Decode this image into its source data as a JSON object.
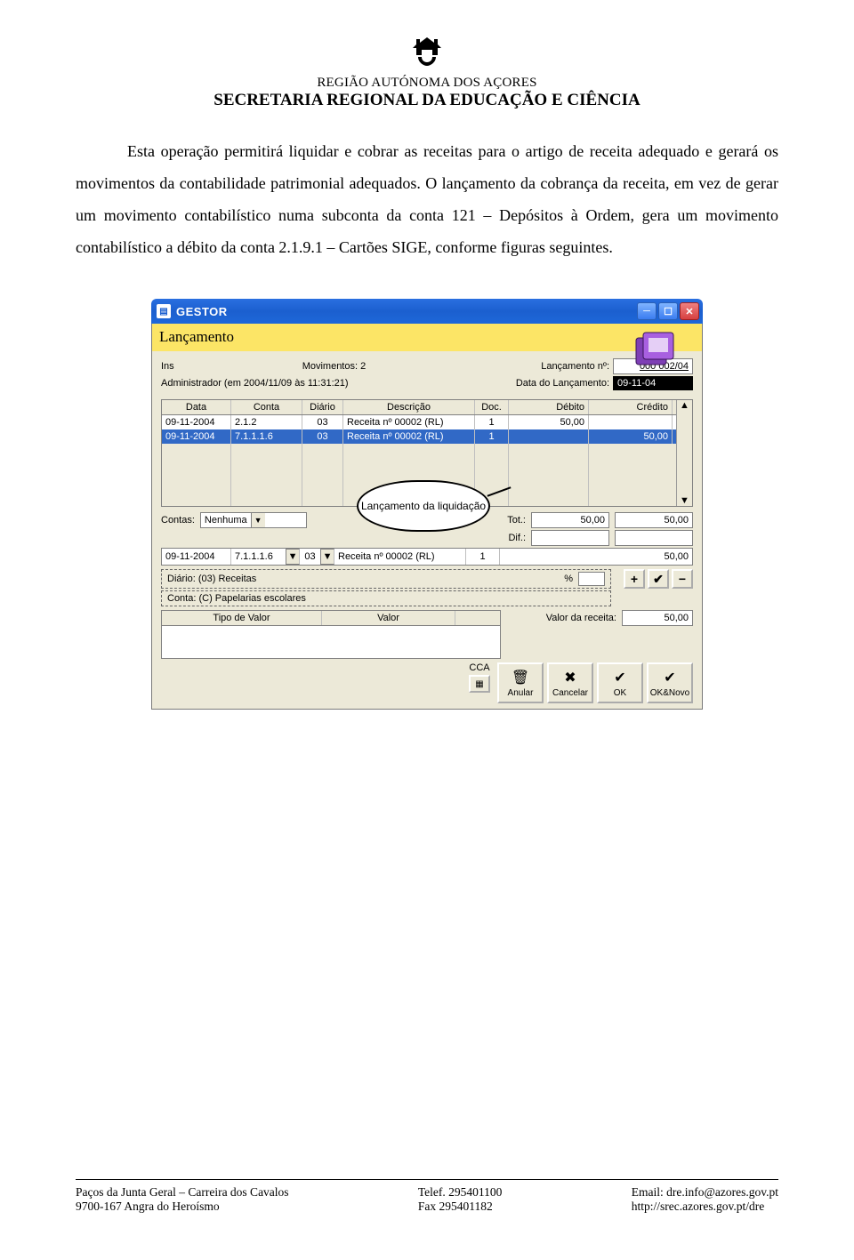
{
  "header": {
    "region": "REGIÃO AUTÓNOMA DOS AÇORES",
    "secretaria": "SECRETARIA REGIONAL DA EDUCAÇÃO E CIÊNCIA"
  },
  "paragraph": "Esta operação permitirá liquidar e cobrar as receitas para o artigo de receita adequado e gerará os movimentos da contabilidade patrimonial adequados. O lançamento da cobrança da receita, em vez de gerar um movimento contabilístico numa subconta da conta 121 – Depósitos à Ordem, gera um movimento contabilístico a débito da conta 2.1.9.1 – Cartões SIGE, conforme figuras seguintes.",
  "callout": "Lançamento da liquidação",
  "app": {
    "title": "GESTOR",
    "section": "Lançamento",
    "ins": "Ins",
    "movimentos_label": "Movimentos: 2",
    "admin_line": "Administrador (em 2004/11/09 às 11:31:21)",
    "lanc_num_label": "Lançamento nº:",
    "lanc_num": "000 002/04",
    "data_lanc_label": "Data do Lançamento:",
    "data_lanc": "09-11-04",
    "grid_head": {
      "data": "Data",
      "conta": "Conta",
      "diario": "Diário",
      "desc": "Descrição",
      "doc": "Doc.",
      "deb": "Débito",
      "cred": "Crédito"
    },
    "rows": [
      {
        "data": "09-11-2004",
        "conta": "2.1.2",
        "diario": "03",
        "desc": "Receita nº 00002 (RL)",
        "doc": "1",
        "deb": "50,00",
        "cred": ""
      },
      {
        "data": "09-11-2004",
        "conta": "7.1.1.1.6",
        "diario": "03",
        "desc": "Receita nº 00002 (RL)",
        "doc": "1",
        "deb": "",
        "cred": "50,00"
      }
    ],
    "contas_label": "Contas:",
    "contas_value": "Nenhuma",
    "tot_label": "Tot.:",
    "dif_label": "Dif.:",
    "tot_deb": "50,00",
    "tot_cred": "50,00",
    "edit": {
      "data": "09-11-2004",
      "conta": "7.1.1.1.6",
      "diario": "03",
      "desc": "Receita nº 00002 (RL)",
      "doc": "1",
      "valor": "50,00"
    },
    "diario_box": "Diário:  (03) Receitas",
    "conta_box": "Conta:  (C) Papelarias escolares",
    "pct_label": "%",
    "lower_head": {
      "tipo": "Tipo de Valor",
      "valor": "Valor"
    },
    "valor_receita_label": "Valor da receita:",
    "valor_receita": "50,00",
    "cca": "CCA",
    "buttons": {
      "anular": "Anular",
      "cancelar": "Cancelar",
      "ok": "OK",
      "oknovo": "OK&Novo"
    }
  },
  "footer": {
    "left1": "Paços da Junta Geral – Carreira dos Cavalos",
    "left2": "9700-167 Angra do Heroísmo",
    "mid1": "Telef.   295401100",
    "mid2": "Fax       295401182",
    "right1": "Email:  dre.info@azores.gov.pt",
    "right2": "http://srec.azores.gov.pt/dre"
  }
}
